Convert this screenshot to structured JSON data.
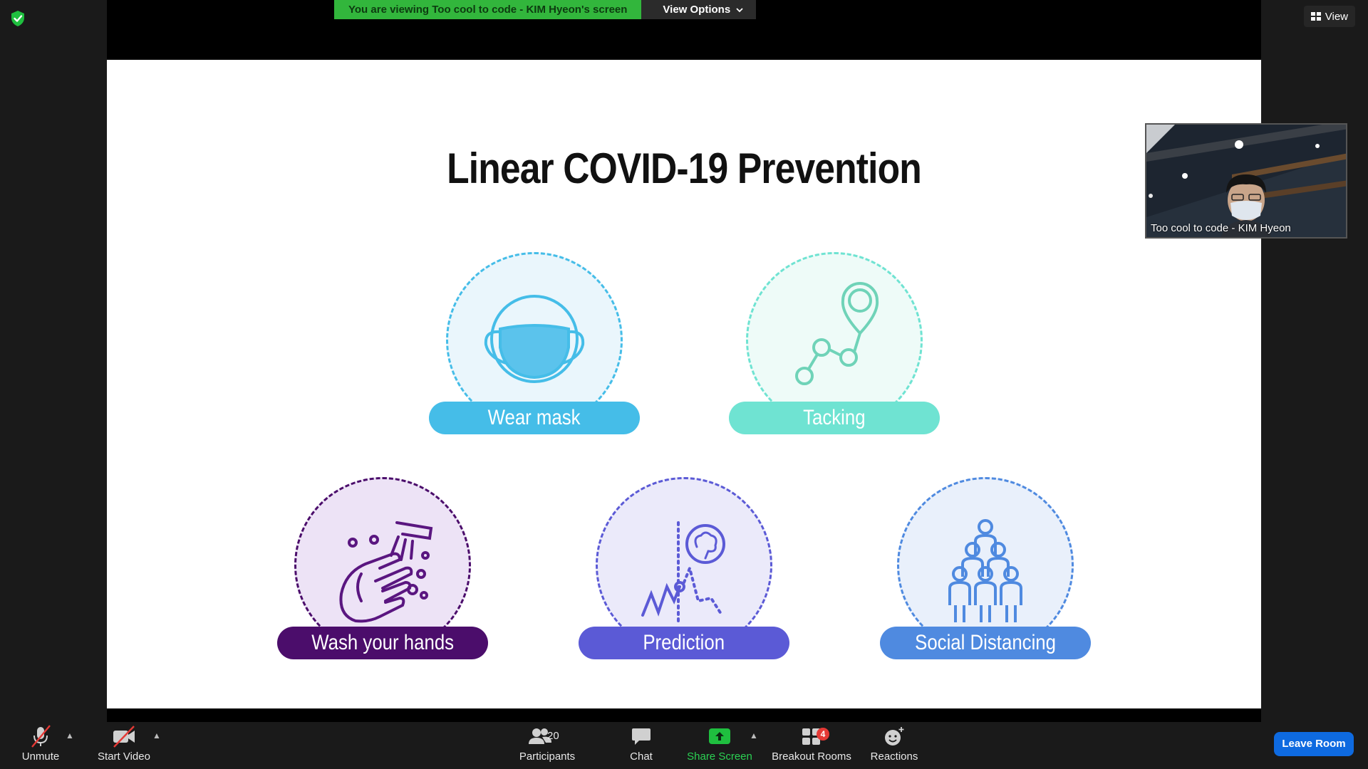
{
  "banner": {
    "viewing_text": "You are viewing Too cool to code - KIM Hyeon's screen",
    "view_options_label": "View Options"
  },
  "view_button_label": "View",
  "slide": {
    "title": "Linear COVID-19 Prevention",
    "items": [
      {
        "label": "Wear mask",
        "icon": "mask-icon",
        "color": "#45bde8",
        "ring": "#45bde8",
        "fill": "#eaf6fc"
      },
      {
        "label": "Tacking",
        "icon": "tracking-icon",
        "color": "#6fe3d2",
        "ring": "#6fe3d2",
        "fill": "#eefbf8"
      },
      {
        "label": "Wash your hands",
        "icon": "hand-wash-icon",
        "color": "#4b0d6b",
        "ring": "#4b0d6b",
        "fill": "#ede3f6"
      },
      {
        "label": "Prediction",
        "icon": "prediction-icon",
        "color": "#5b5ad6",
        "ring": "#5b5ad6",
        "fill": "#ebeafa"
      },
      {
        "label": "Social Distancing",
        "icon": "social-distancing-icon",
        "color": "#4f8ae0",
        "ring": "#4f8ae0",
        "fill": "#e9f0fb"
      }
    ]
  },
  "video_tile": {
    "name": "Too cool to code - KIM Hyeon"
  },
  "toolbar": {
    "unmute_label": "Unmute",
    "start_video_label": "Start Video",
    "participants_label": "Participants",
    "participants_count": "20",
    "chat_label": "Chat",
    "share_screen_label": "Share Screen",
    "breakout_rooms_label": "Breakout Rooms",
    "breakout_rooms_badge": "4",
    "reactions_label": "Reactions",
    "leave_label": "Leave Room"
  },
  "colors": {
    "banner_green": "#32b63c",
    "share_green": "#1fbf3f",
    "leave_blue": "#0e6ae0",
    "badge_red": "#e53935"
  }
}
